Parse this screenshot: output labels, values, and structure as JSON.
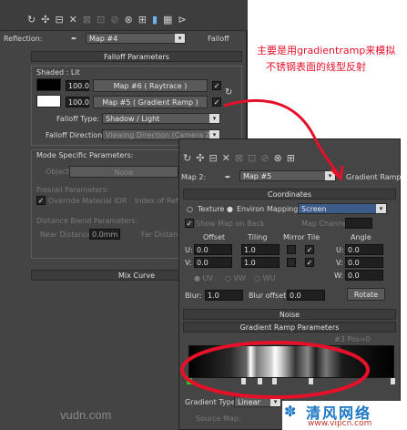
{
  "annotation": {
    "line1": "主要是用gradientramp来模拟",
    "line2": "不锈钢表面的线型反射"
  },
  "panel1": {
    "reflection_label": "Reflection:",
    "map_name": "Map #4",
    "map_type": "Falloff",
    "falloff_params_title": "Falloff Parameters",
    "shaded_label": "Shaded : Lit",
    "row1": {
      "amount": "100.0",
      "map": "Map #6 ( Raytrace )"
    },
    "row2": {
      "amount": "100.0",
      "map": "Map #5 ( Gradient Ramp )"
    },
    "falloff_type_label": "Falloff Type:",
    "falloff_type_value": "Shadow / Light",
    "falloff_dir_label": "Falloff Direction:",
    "falloff_dir_value": "Viewing Direction (Camera Z-Axis)",
    "mode_specific_label": "Mode Specific Parameters:",
    "object_label": "Object:",
    "object_value": "None",
    "fresnel_label": "Fresnel Parameters:",
    "override_ior_label": "Override Material IOR",
    "index_refr_label": "Index of Refra",
    "distance_blend_label": "Distance Blend Parameters:",
    "near_label": "Near Distance:",
    "near_value": "0.0mm",
    "far_label": "Far Distance",
    "mix_curve_title": "Mix Curve"
  },
  "panel2": {
    "map_label": "Map 2:",
    "map_name": "Map #5",
    "map_type": "Gradient Ramp",
    "coordinates_title": "Coordinates",
    "texture_label": "Texture",
    "environ_label": "Environ",
    "mapping_label": "Mapping:",
    "mapping_value": "Screen",
    "show_map_label": "Show Map on Back",
    "map_channel_label": "Map Channel:",
    "offset_label": "Offset",
    "tiling_label": "Tiling",
    "mirror_tile_label": "Mirror Tile",
    "angle_label": "Angle",
    "u_label": "U:",
    "v_label": "V:",
    "w_label": "W:",
    "u_offset": "0.0",
    "v_offset": "0.0",
    "u_tiling": "1.0",
    "v_tiling": "1.0",
    "u_angle": "0.0",
    "v_angle": "0.0",
    "w_angle": "0.0",
    "uv_label": "UV",
    "vw_label": "VW",
    "wu_label": "WU",
    "blur_label": "Blur:",
    "blur_value": "1.0",
    "blur_offset_label": "Blur offset:",
    "blur_offset_value": "0.0",
    "rotate_label": "Rotate",
    "noise_title": "Noise",
    "gradient_ramp_title": "Gradient Ramp Parameters",
    "ramp_status": "#3 Pos=0",
    "gradient_type_label": "Gradient Type:",
    "gradient_type_value": "Linear",
    "source_map_label": "Source Map:"
  },
  "watermark": {
    "left": "vudn.com",
    "right_title": "清风网络",
    "right_url": "www.vipcn.com"
  }
}
